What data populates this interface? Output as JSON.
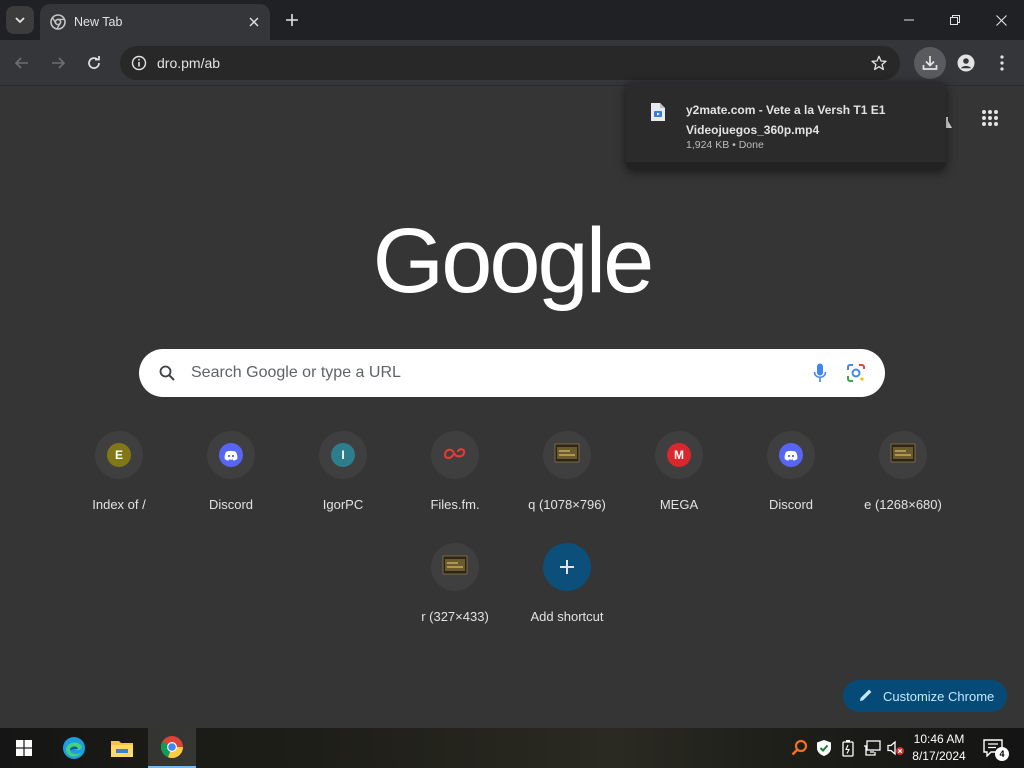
{
  "browser": {
    "tab": {
      "title": "New Tab"
    },
    "address_bar": {
      "url": "dro.pm/ab"
    }
  },
  "download_bubble": {
    "file_name": "y2mate.com - Vete a la Versh  T1 E1 Videojuegos_360p.mp4",
    "status": "1,924 KB • Done"
  },
  "ntp": {
    "logo_text": "Google",
    "search": {
      "placeholder": "Search Google or type a URL"
    },
    "shortcuts": [
      {
        "label": "Index of /",
        "icon": "letter-e-icon",
        "letter": "E",
        "color": "#827717"
      },
      {
        "label": "Discord",
        "icon": "discord-icon",
        "color": "#5865f2"
      },
      {
        "label": "IgorPC",
        "icon": "letter-i-icon",
        "letter": "I",
        "color": "#2e7d8c"
      },
      {
        "label": "Files.fm.",
        "icon": "files-fm-icon",
        "color": "#e53935"
      },
      {
        "label": "q (1078×796)",
        "icon": "image-thumb-icon",
        "color": "#6b5a2e"
      },
      {
        "label": "MEGA",
        "icon": "mega-icon",
        "letter": "M",
        "color": "#d9272e"
      },
      {
        "label": "Discord",
        "icon": "discord-icon",
        "color": "#5865f2"
      },
      {
        "label": "e (1268×680)",
        "icon": "image-thumb-icon",
        "color": "#6b5a2e"
      },
      {
        "label": "r (327×433)",
        "icon": "image-thumb-icon",
        "color": "#6b5a2e"
      },
      {
        "label": "Add shortcut",
        "icon": "plus-icon",
        "color": "#0b4f7a"
      }
    ],
    "customize_label": "Customize Chrome"
  },
  "taskbar": {
    "time": "10:46 AM",
    "date": "8/17/2024",
    "notification_count": "4"
  },
  "colors": {
    "page_bg": "#353535",
    "tabstrip_bg": "#202124",
    "toolbar_bg": "#35363a",
    "accent_blue": "#064b78"
  }
}
